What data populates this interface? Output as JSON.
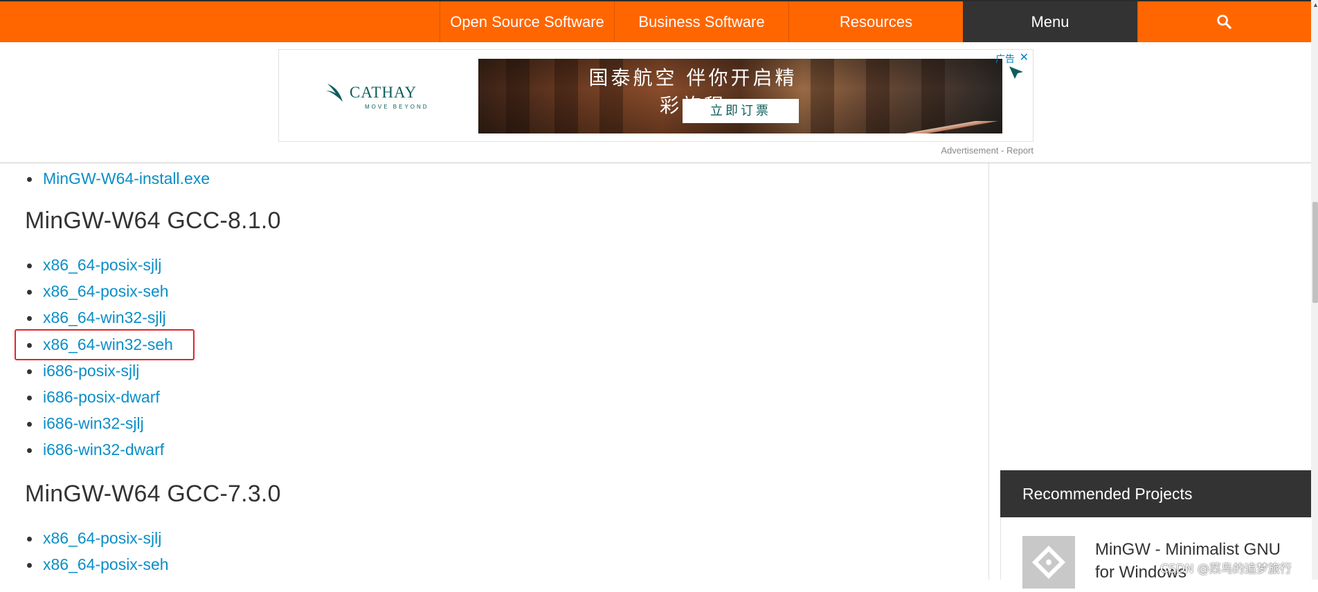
{
  "nav": {
    "items": [
      "Open Source Software",
      "Business Software",
      "Resources"
    ],
    "menu_label": "Menu",
    "search_icon": "search-icon"
  },
  "ad": {
    "brand_name": "CATHAY",
    "brand_tagline": "MOVE BEYOND",
    "headline": "国泰航空 伴你开启精彩旅程",
    "cta": "立即订票",
    "label": "广告",
    "close": "✕",
    "report": "Advertisement - Report"
  },
  "content": {
    "top_links": [
      "MinGW-W64-install.exe"
    ],
    "sections": [
      {
        "heading": "MinGW-W64 GCC-8.1.0",
        "links": [
          "x86_64-posix-sjlj",
          "x86_64-posix-seh",
          "x86_64-win32-sjlj",
          "x86_64-win32-seh",
          "i686-posix-sjlj",
          "i686-posix-dwarf",
          "i686-win32-sjlj",
          "i686-win32-dwarf"
        ]
      },
      {
        "heading": "MinGW-W64 GCC-7.3.0",
        "links": [
          "x86_64-posix-sjlj",
          "x86_64-posix-seh"
        ]
      }
    ],
    "highlighted_link": "x86_64-win32-seh"
  },
  "sidebar": {
    "recommended_title": "Recommended Projects",
    "project_title": "MinGW - Minimalist GNU for Windows"
  },
  "watermark": "CSDN @菜鸟的追梦旅行",
  "colors": {
    "nav_orange": "#ff6600",
    "menu_dark": "#333333",
    "link_blue": "#0a8ec8",
    "highlight_red": "#e0262b",
    "cathay_green": "#0e5e5b"
  }
}
